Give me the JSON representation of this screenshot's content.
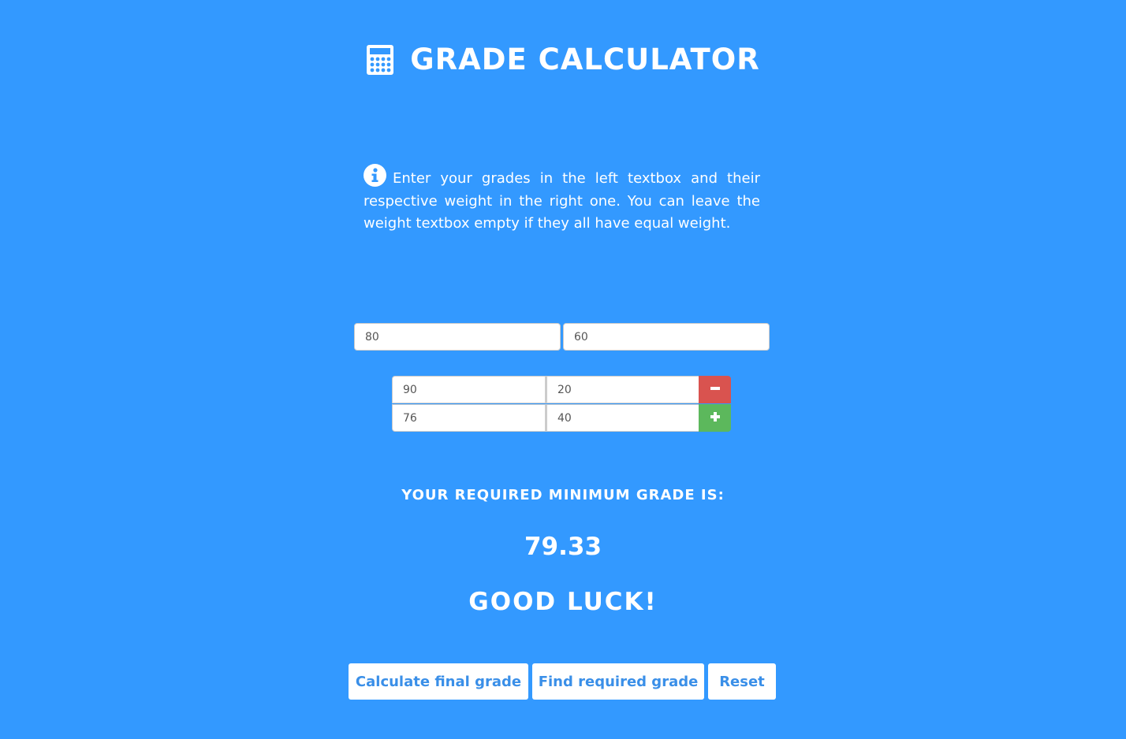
{
  "header": {
    "title": "GRADE CALCULATOR",
    "icon": "calculator-icon"
  },
  "info": {
    "icon": "info-circle-icon",
    "text": "Enter your grades in the left textbox and their respective weight in the right one. You can leave the weight textbox empty if they all have equal weight."
  },
  "inputs": {
    "top_grade": "80",
    "top_weight": "60",
    "rows": [
      {
        "grade": "90",
        "weight": "20"
      },
      {
        "grade": "76",
        "weight": "40"
      }
    ]
  },
  "row_buttons": {
    "remove_icon": "minus-icon",
    "add_icon": "plus-icon",
    "remove_color": "#d9534f",
    "add_color": "#5cb85c"
  },
  "result": {
    "label": "YOUR REQUIRED MINIMUM GRADE IS:",
    "value": "79.33",
    "message": "GOOD LUCK!"
  },
  "actions": {
    "calculate_label": "Calculate final grade",
    "find_label": "Find required grade",
    "reset_label": "Reset"
  },
  "colors": {
    "background": "#3399ff",
    "button_text": "#3a8fe8"
  }
}
